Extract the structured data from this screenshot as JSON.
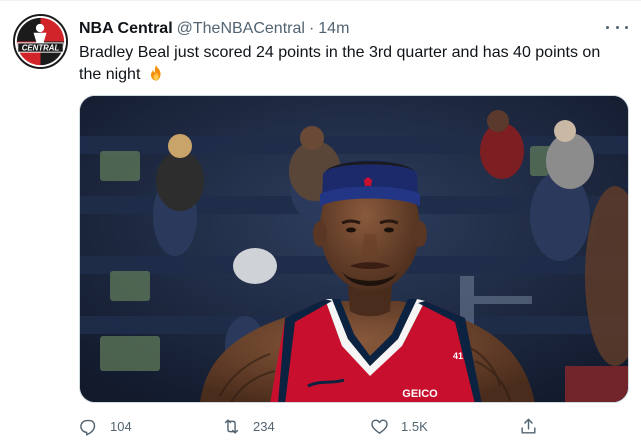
{
  "tweet": {
    "author_name": "NBA Central",
    "handle": "@TheNBACentral",
    "separator": "·",
    "time": "14m",
    "text": "Bradley Beal just scored 24 points in the 3rd quarter and has 40 points on the night"
  },
  "avatar": {
    "logo_text": "CENTRAL"
  },
  "media": {
    "jersey_sponsor": "GEICO",
    "jersey_number": "41"
  },
  "actions": {
    "reply_count": "104",
    "retweet_count": "234",
    "like_count": "1.5K"
  },
  "icons": {
    "reply": "reply-icon",
    "retweet": "retweet-icon",
    "like": "heart-icon",
    "share": "share-icon",
    "more": "more-icon",
    "emoji": "fire-emoji"
  },
  "colors": {
    "text_primary": "#0f1419",
    "text_secondary": "#536471",
    "logo_red": "#d1232a",
    "jersey_red": "#c8102e",
    "jersey_navy": "#0b2240"
  }
}
